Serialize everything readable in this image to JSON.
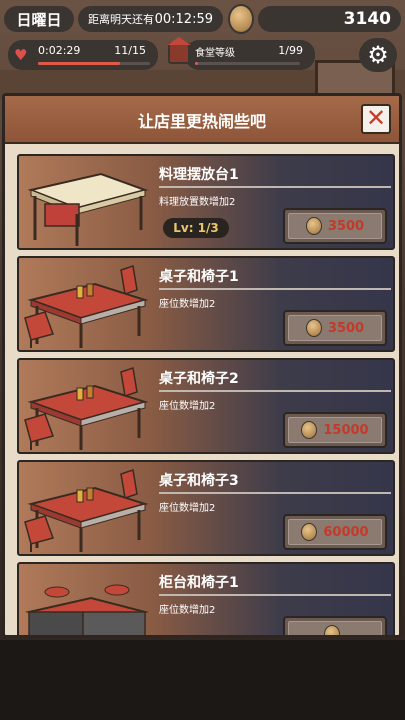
{
  "status": {
    "day": "日曜日",
    "countdown_label": "距离明天还有",
    "countdown": "00:12:59",
    "coins": "3140"
  },
  "life": {
    "timer": "0:02:29",
    "count": "11/15",
    "fill": 0.73
  },
  "restaurant_level": {
    "label": "食堂等级",
    "count": "1/99",
    "fill": 0.01
  },
  "icons": {
    "heart": "heart-icon",
    "shop": "shop-icon",
    "coin": "coin-icon",
    "gear": "gear-icon",
    "close": "close-icon"
  },
  "modal": {
    "title": "让店里更热闹些吧",
    "close_glyph": "✕"
  },
  "items": [
    {
      "name": "料理摆放台1",
      "desc": "料理放置数增加2",
      "level": "Lv: 1/3",
      "price": "3500",
      "image": "food-table"
    },
    {
      "name": "桌子和椅子1",
      "desc": "座位数增加2",
      "level": "",
      "price": "3500",
      "image": "table-chairs"
    },
    {
      "name": "桌子和椅子2",
      "desc": "座位数增加2",
      "level": "",
      "price": "15000",
      "image": "table-chairs"
    },
    {
      "name": "桌子和椅子3",
      "desc": "座位数增加2",
      "level": "",
      "price": "60000",
      "image": "table-chairs"
    },
    {
      "name": "柜台和椅子1",
      "desc": "座位数增加2",
      "level": "",
      "price": "",
      "image": "counter-chairs"
    }
  ],
  "colors": {
    "accent_red": "#c43a2a",
    "header_brown": "#a56a4a",
    "pill_dark": "#3b3532"
  }
}
